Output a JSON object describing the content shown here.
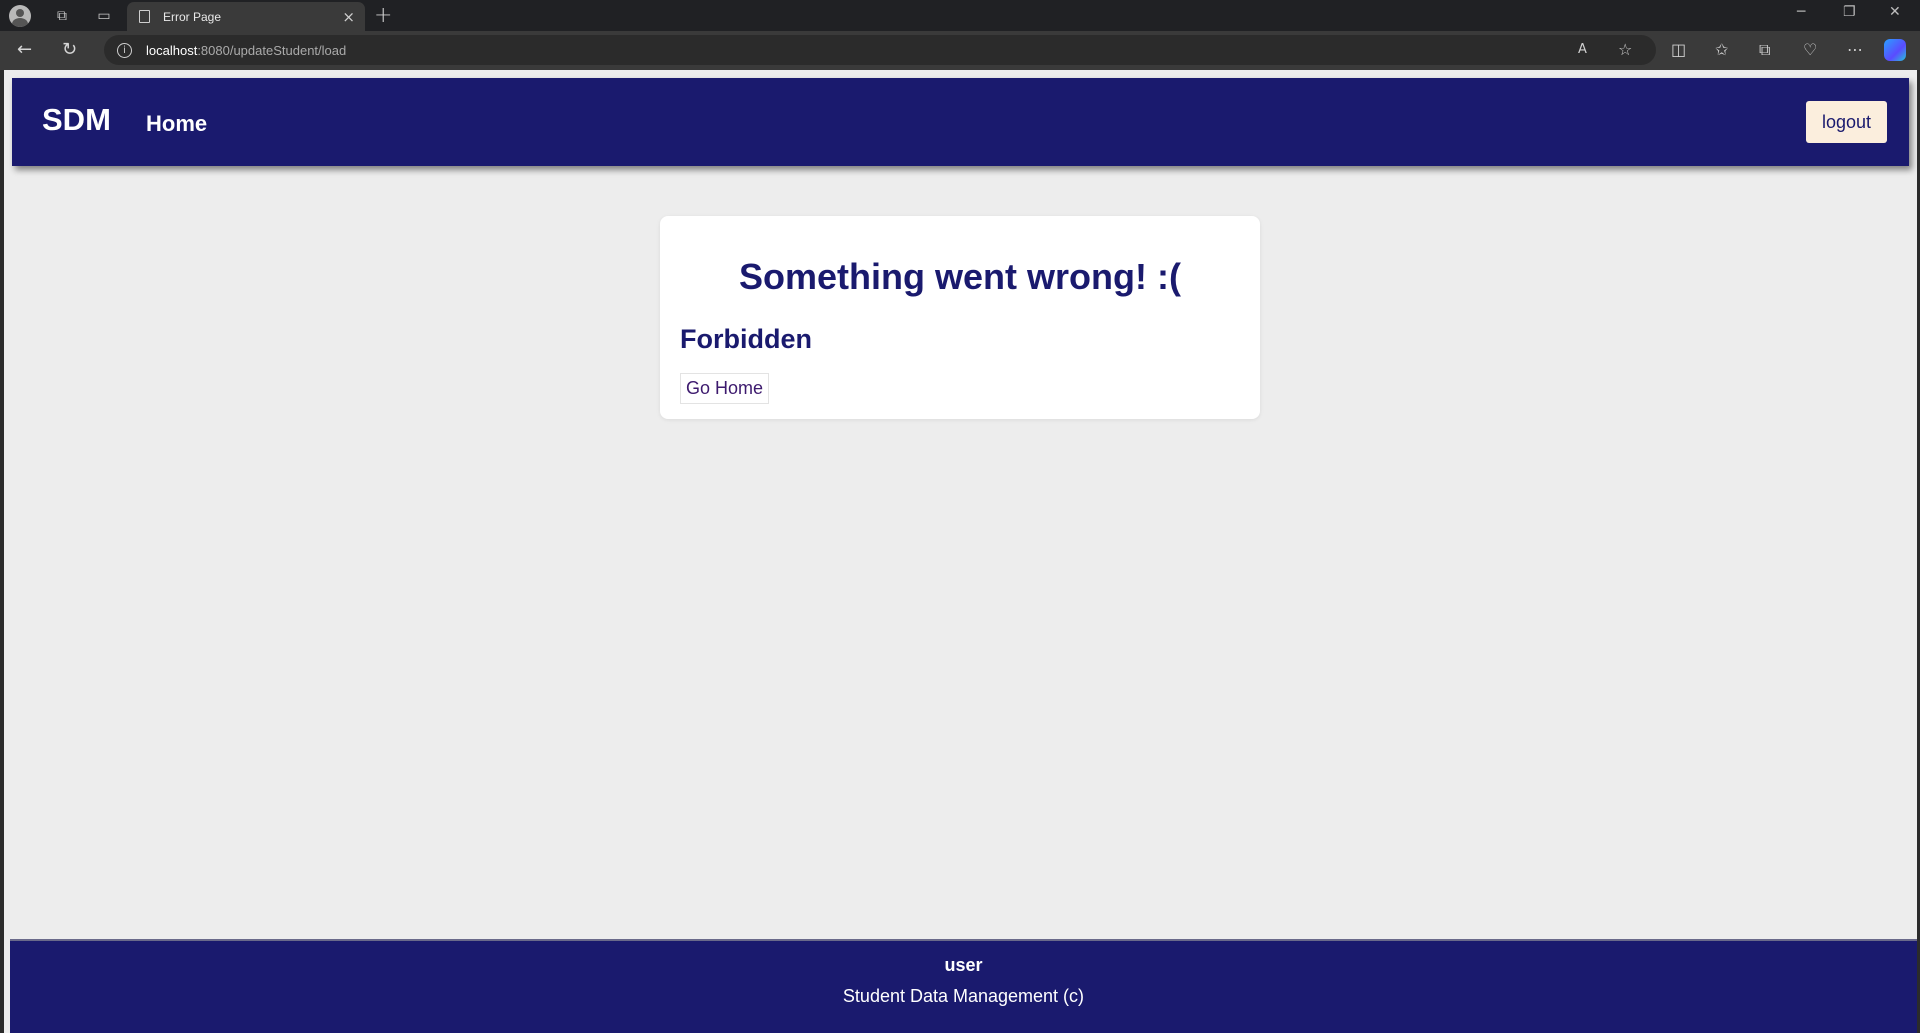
{
  "browser": {
    "tab_title": "Error Page",
    "url_host": "localhost",
    "url_path": ":8080/updateStudent/load",
    "new_tab_glyph": "+",
    "close_glyph": "×"
  },
  "header": {
    "brand": "SDM",
    "home_link": "Home",
    "logout_label": "logout"
  },
  "error_card": {
    "heading": "Something went wrong! :(",
    "message": "Forbidden",
    "go_home_label": "Go Home"
  },
  "footer": {
    "user": "user",
    "copyright": "Student Data Management (c)"
  },
  "colors": {
    "brand_navy": "#1a1a6e",
    "logout_bg": "#fbeedd",
    "page_bg": "#ededed"
  }
}
